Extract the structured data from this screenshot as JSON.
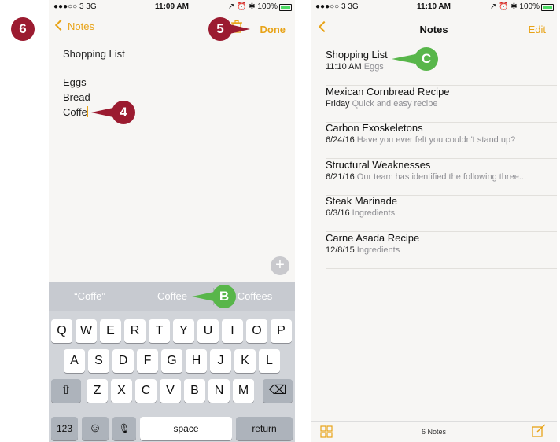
{
  "left_screen": {
    "status": {
      "carrier": "●●●○○ 3  3G",
      "time": "11:09 AM",
      "right": "↗ ⏰ ✱ 100%"
    },
    "nav": {
      "back_label": "Notes",
      "done_label": "Done"
    },
    "note_lines": [
      "Shopping List",
      "Eggs",
      "Bread",
      "Coffe"
    ],
    "plus_label": "+",
    "suggestions": [
      "“Coffe”",
      "Coffee",
      "Coffees"
    ],
    "keyboard": {
      "row1": [
        "Q",
        "W",
        "E",
        "R",
        "T",
        "Y",
        "U",
        "I",
        "O",
        "P"
      ],
      "row2": [
        "A",
        "S",
        "D",
        "F",
        "G",
        "H",
        "J",
        "K",
        "L"
      ],
      "row3": [
        "Z",
        "X",
        "C",
        "V",
        "B",
        "N",
        "M"
      ],
      "shift_label": "⇧",
      "delete_label": "⌫",
      "numbers_label": "123",
      "emoji_label": "☺",
      "mic_label": "🎙",
      "space_label": "space",
      "return_label": "return"
    }
  },
  "right_screen": {
    "status": {
      "carrier": "●●●○○ 3  3G",
      "time": "11:10 AM",
      "right": "↗ ⏰ ✱ 100%"
    },
    "nav": {
      "title": "Notes",
      "edit_label": "Edit"
    },
    "notes": [
      {
        "title": "Shopping List",
        "date": "11:10 AM",
        "preview": "Eggs"
      },
      {
        "title": "Mexican Cornbread Recipe",
        "date": "Friday",
        "preview": "Quick and easy recipe"
      },
      {
        "title": "Carbon Exoskeletons",
        "date": "6/24/16",
        "preview": "Have you ever felt you couldn't stand up?"
      },
      {
        "title": "Structural Weaknesses",
        "date": "6/21/16",
        "preview": "Our team has identified the following three..."
      },
      {
        "title": "Steak Marinade",
        "date": "6/3/16",
        "preview": "Ingredients"
      },
      {
        "title": "Carne Asada Recipe",
        "date": "12/8/15",
        "preview": "Ingredients"
      }
    ],
    "toolbar": {
      "count_label": "6 Notes"
    }
  },
  "callouts": [
    "6",
    "5",
    "4",
    "B",
    "C"
  ],
  "colors": {
    "accent": "#e8a317",
    "callout_red": "#9b1b30",
    "callout_green": "#58b64a"
  }
}
